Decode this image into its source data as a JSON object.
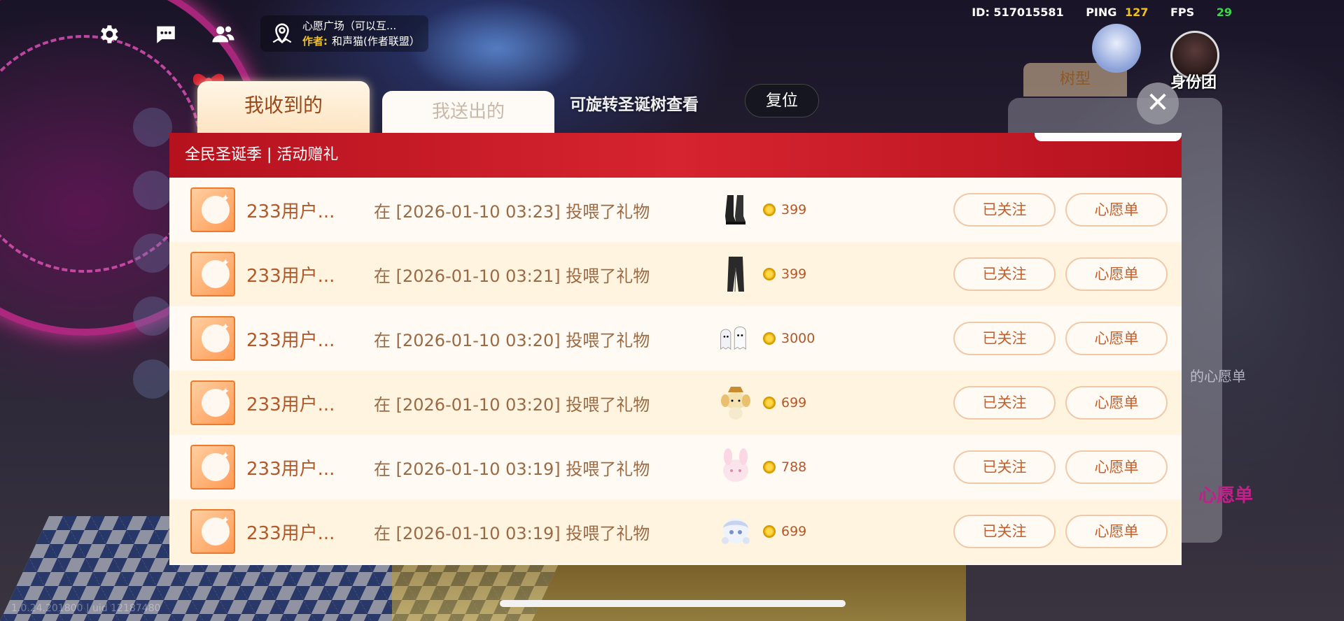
{
  "hud": {
    "id_label": "ID: 517015581",
    "ping_label": "PING",
    "ping_value": "127",
    "fps_label": "FPS",
    "fps_value": "29",
    "location_title": "心愿广场（可以互...",
    "author_label": "作者:",
    "author_name": "和声猫(作者联盟）",
    "icons": [
      "gear-icon",
      "chat-icon",
      "friends-icon",
      "location-icon"
    ]
  },
  "tabs": {
    "received": "我收到的",
    "sent": "我送出的",
    "active": "received"
  },
  "rotate_hint": "可旋转圣诞树查看",
  "reset_label": "复位",
  "close_label": "✕",
  "background": {
    "tree_type_tab": "树型",
    "wishlist_label": "的心愿单",
    "wishlist_big": "心愿单",
    "identity_label": "身份团",
    "version_text": "1.0.24.201800 | uid 12187480"
  },
  "modal": {
    "title": "全民圣诞季 | 活动赠礼",
    "rows": [
      {
        "user": "233用户...",
        "desc": "在 [2026-01-10 03:23] 投喂了礼物",
        "gift": "boots",
        "price": "399",
        "follow": "已关注",
        "wishlist": "心愿单"
      },
      {
        "user": "233用户...",
        "desc": "在 [2026-01-10 03:21] 投喂了礼物",
        "gift": "pants",
        "price": "399",
        "follow": "已关注",
        "wishlist": "心愿单"
      },
      {
        "user": "233用户...",
        "desc": "在 [2026-01-10 03:20] 投喂了礼物",
        "gift": "ghost-pets",
        "price": "3000",
        "follow": "已关注",
        "wishlist": "心愿单"
      },
      {
        "user": "233用户...",
        "desc": "在 [2026-01-10 03:20] 投喂了礼物",
        "gift": "dog-plush",
        "price": "699",
        "follow": "已关注",
        "wishlist": "心愿单"
      },
      {
        "user": "233用户...",
        "desc": "在 [2026-01-10 03:19] 投喂了礼物",
        "gift": "bunny-hat",
        "price": "788",
        "follow": "已关注",
        "wishlist": "心愿单"
      },
      {
        "user": "233用户...",
        "desc": "在 [2026-01-10 03:19] 投喂了礼物",
        "gift": "doll-head",
        "price": "699",
        "follow": "已关注",
        "wishlist": "心愿单"
      }
    ]
  },
  "colors": {
    "header_red": "#c41a24",
    "accent_orange": "#c45f2c",
    "ping_yellow": "#f3c21c",
    "fps_green": "#3ed64a"
  }
}
